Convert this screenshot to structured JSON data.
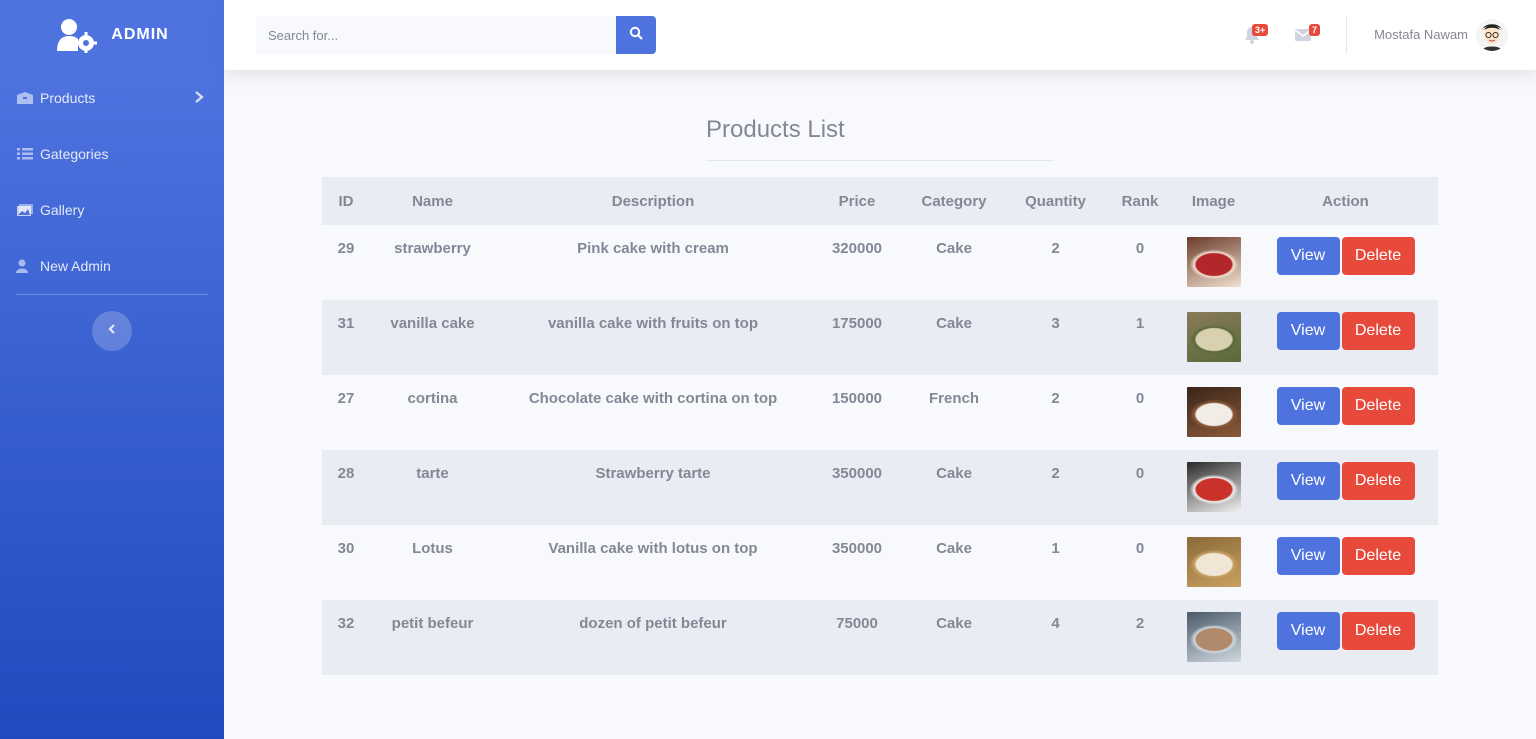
{
  "brand": {
    "title": "ADMIN"
  },
  "sidebar": {
    "items": [
      {
        "label": "Products",
        "icon": "box-icon"
      },
      {
        "label": "Gategories",
        "icon": "list-icon"
      },
      {
        "label": "Gallery",
        "icon": "images-icon"
      },
      {
        "label": "New Admin",
        "icon": "user-icon"
      }
    ]
  },
  "topbar": {
    "search_placeholder": "Search for...",
    "alerts_count": "3+",
    "messages_count": "7",
    "user_name": "Mostafa Nawam"
  },
  "main": {
    "title": "Products List",
    "columns": [
      "ID",
      "Name",
      "Description",
      "Price",
      "Category",
      "Quantity",
      "Rank",
      "Image",
      "Action"
    ],
    "view_label": "View",
    "delete_label": "Delete",
    "rows": [
      {
        "id": "29",
        "name": "strawberry",
        "description": "Pink cake with cream",
        "price": "320000",
        "category": "Cake",
        "quantity": "2",
        "rank": "0"
      },
      {
        "id": "31",
        "name": "vanilla cake",
        "description": "vanilla cake with fruits on top",
        "price": "175000",
        "category": "Cake",
        "quantity": "3",
        "rank": "1"
      },
      {
        "id": "27",
        "name": "cortina",
        "description": "Chocolate cake with cortina on top",
        "price": "150000",
        "category": "French",
        "quantity": "2",
        "rank": "0"
      },
      {
        "id": "28",
        "name": "tarte",
        "description": "Strawberry tarte",
        "price": "350000",
        "category": "Cake",
        "quantity": "2",
        "rank": "0"
      },
      {
        "id": "30",
        "name": "Lotus",
        "description": "Vanilla cake with lotus on top",
        "price": "350000",
        "category": "Cake",
        "quantity": "1",
        "rank": "0"
      },
      {
        "id": "32",
        "name": "petit befeur",
        "description": "dozen of petit befeur",
        "price": "75000",
        "category": "Cake",
        "quantity": "4",
        "rank": "2"
      }
    ]
  },
  "colors": {
    "primary": "#4e73df",
    "danger": "#e74a3b",
    "text_muted": "#858796"
  }
}
